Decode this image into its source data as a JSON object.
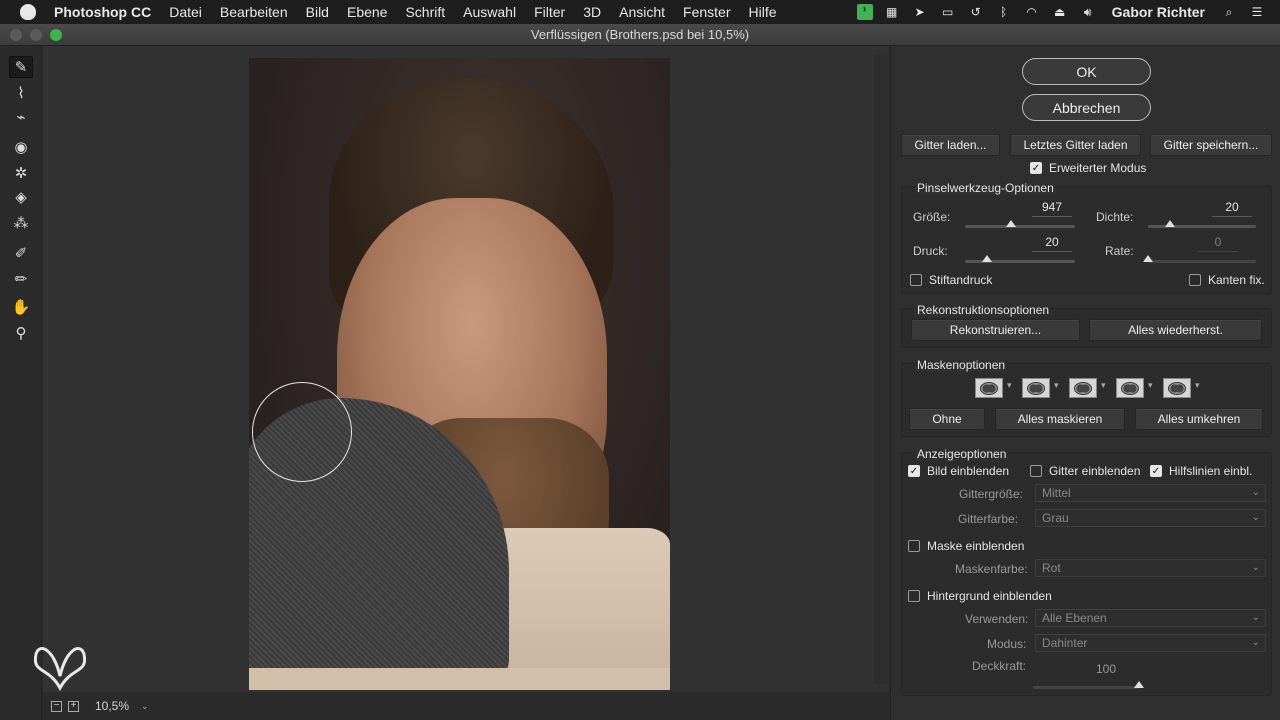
{
  "menubar": {
    "app": "Photoshop CC",
    "items": [
      "Datei",
      "Bearbeiten",
      "Bild",
      "Ebene",
      "Schrift",
      "Auswahl",
      "Filter",
      "3D",
      "Ansicht",
      "Fenster",
      "Hilfe"
    ],
    "user": "Gabor Richter"
  },
  "window": {
    "title": "Verflüssigen (Brothers.psd bei 10,5%)"
  },
  "status": {
    "zoom": "10,5%"
  },
  "buttons": {
    "ok": "OK",
    "cancel": "Abbrechen"
  },
  "mesh": {
    "load": "Gitter laden...",
    "load_last": "Letztes Gitter laden",
    "save": "Gitter speichern..."
  },
  "advanced_mode": {
    "label": "Erweiterter Modus",
    "checked": true
  },
  "brush_options": {
    "title": "Pinselwerkzeug-Optionen",
    "size_label": "Größe:",
    "size_value": "947",
    "size_level": 0.42,
    "density_label": "Dichte:",
    "density_value": "20",
    "density_level": 0.2,
    "pressure_label": "Druck:",
    "pressure_value": "20",
    "pressure_level": 0.2,
    "rate_label": "Rate:",
    "rate_value": "0",
    "rate_level": 0.0,
    "stylus_label": "Stiftandruck",
    "stylus_checked": false,
    "pin_edges_label": "Kanten fix.",
    "pin_edges_checked": false
  },
  "reconstruct": {
    "title": "Rekonstruktionsoptionen",
    "reconstruct": "Rekonstruieren...",
    "restore_all": "Alles wiederherst."
  },
  "mask": {
    "title": "Maskenoptionen",
    "none": "Ohne",
    "mask_all": "Alles maskieren",
    "invert_all": "Alles umkehren"
  },
  "view": {
    "title": "Anzeigeoptionen",
    "show_image": "Bild einblenden",
    "show_image_checked": true,
    "show_mesh": "Gitter einblenden",
    "show_mesh_checked": false,
    "show_guides": "Hilfslinien einbl.",
    "show_guides_checked": true,
    "mesh_size_label": "Gittergröße:",
    "mesh_size_value": "Mittel",
    "mesh_color_label": "Gitterfarbe:",
    "mesh_color_value": "Grau",
    "show_mask": "Maske einblenden",
    "show_mask_checked": false,
    "mask_color_label": "Maskenfarbe:",
    "mask_color_value": "Rot",
    "show_backdrop": "Hintergrund einblenden",
    "show_backdrop_checked": false,
    "use_label": "Verwenden:",
    "use_value": "Alle Ebenen",
    "mode_label": "Modus:",
    "mode_value": "Dahinter",
    "opacity_label": "Deckkraft:",
    "opacity_value": "100",
    "opacity_level": 1.0
  },
  "colors": {
    "accent_green": "#3bb54a",
    "panel_bg": "#2f2f2f"
  }
}
